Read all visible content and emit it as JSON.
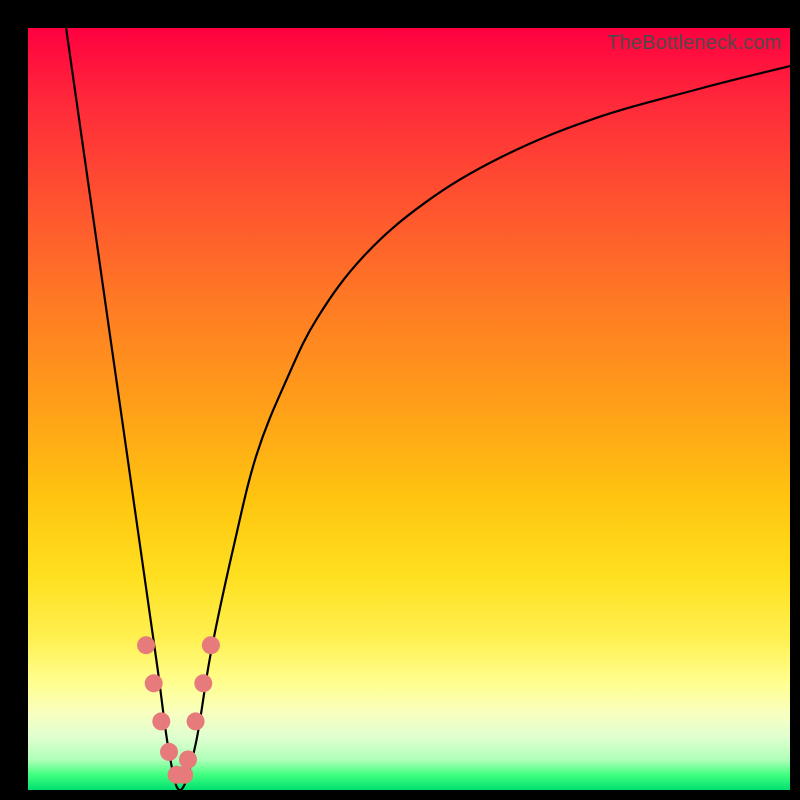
{
  "watermark": "TheBottleneck.com",
  "chart_data": {
    "type": "line",
    "title": "",
    "xlabel": "",
    "ylabel": "",
    "xlim": [
      0,
      100
    ],
    "ylim": [
      0,
      100
    ],
    "series": [
      {
        "name": "bottleneck-curve",
        "x": [
          5,
          7,
          9,
          11,
          13,
          15,
          17,
          18.5,
          20,
          22,
          24,
          27,
          30,
          34,
          38,
          44,
          52,
          62,
          74,
          88,
          100
        ],
        "values": [
          100,
          86,
          72,
          58,
          44,
          30,
          16,
          5,
          0,
          6,
          18,
          32,
          44,
          54,
          62,
          70,
          77,
          83,
          88,
          92,
          95
        ]
      }
    ],
    "markers": {
      "name": "highlight-dots",
      "color": "#e77a7a",
      "points": [
        {
          "x": 15.5,
          "y": 19
        },
        {
          "x": 16.5,
          "y": 14
        },
        {
          "x": 17.5,
          "y": 9
        },
        {
          "x": 18.5,
          "y": 5
        },
        {
          "x": 19.5,
          "y": 2
        },
        {
          "x": 20.5,
          "y": 2
        },
        {
          "x": 21.0,
          "y": 4
        },
        {
          "x": 22.0,
          "y": 9
        },
        {
          "x": 23.0,
          "y": 14
        },
        {
          "x": 24.0,
          "y": 19
        }
      ]
    },
    "gradient_stops": [
      {
        "pos": 0,
        "color": "#ff0040"
      },
      {
        "pos": 50,
        "color": "#ffa018"
      },
      {
        "pos": 80,
        "color": "#fff050"
      },
      {
        "pos": 100,
        "color": "#00e070"
      }
    ]
  }
}
